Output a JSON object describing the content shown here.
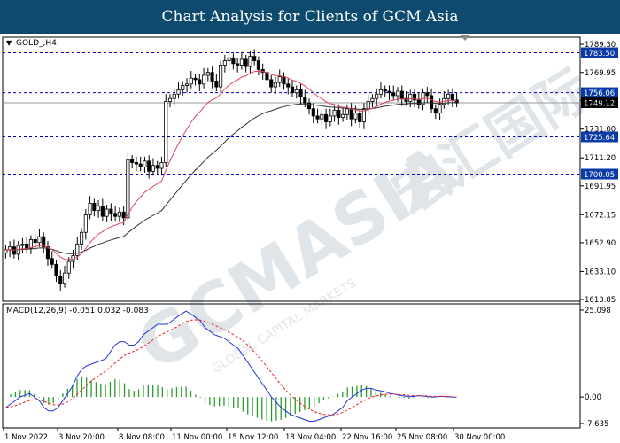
{
  "banner": {
    "title": "Chart Analysis for Clients of GCM Asia"
  },
  "watermark": {
    "text": "GCMASIA",
    "chinese": "宏汇国际",
    "sub": "GLOBAL CAPITAL MARKETS"
  },
  "colors": {
    "bull_candle": "#000000",
    "bear_candle": "#000000",
    "ma_fast": "#e0455a",
    "ma_slow": "#333333",
    "level_line": "#0000cc",
    "current_line": "#999999",
    "macd_line": "#2233dd",
    "signal_line": "#ee2222",
    "histogram": "#2e9a2e",
    "tag_blue": "#0a3aa8"
  },
  "chart_data": [
    {
      "type": "candlestick",
      "symbol_label": "GOLD_,H4",
      "ylim": [
        1613.85,
        1789.3
      ],
      "y_ticks": [
        1789.3,
        1769.95,
        1750.6,
        1731.0,
        1711.2,
        1691.95,
        1672.15,
        1652.9,
        1633.1,
        1613.85
      ],
      "y_tick_labels": [
        "1789.30",
        "1769.95",
        "1750.60",
        "1731.00",
        "1711.20",
        "1691.95",
        "1672.15",
        "1652.90",
        "1633.10",
        "1613.85"
      ],
      "x_labels": [
        "1 Nov 2022",
        "3 Nov 20:00",
        "8 Nov 08:00",
        "11 Nov 00:00",
        "15 Nov 12:00",
        "18 Nov 04:00",
        "22 Nov 16:00",
        "25 Nov 08:00",
        "30 Nov 00:00"
      ],
      "levels": [
        {
          "value": 1783.5,
          "label": "1783.50"
        },
        {
          "value": 1756.06,
          "label": "1756.06"
        },
        {
          "value": 1725.64,
          "label": "1725.64"
        },
        {
          "value": 1700.05,
          "label": "1700.05"
        }
      ],
      "current_price": {
        "value": 1749.12,
        "label": "1749.12"
      },
      "closes": [
        1648,
        1650,
        1645,
        1651,
        1652,
        1649,
        1655,
        1653,
        1657,
        1650,
        1642,
        1638,
        1630,
        1625,
        1632,
        1640,
        1644,
        1652,
        1660,
        1672,
        1680,
        1675,
        1678,
        1671,
        1676,
        1673,
        1671,
        1674,
        1670,
        1710,
        1708,
        1707,
        1705,
        1709,
        1702,
        1706,
        1704,
        1708,
        1750,
        1752,
        1755,
        1758,
        1761,
        1762,
        1766,
        1765,
        1762,
        1768,
        1770,
        1764,
        1760,
        1775,
        1778,
        1780,
        1776,
        1775,
        1779,
        1774,
        1781,
        1778,
        1772,
        1770,
        1765,
        1760,
        1763,
        1767,
        1762,
        1760,
        1756,
        1758,
        1753,
        1749,
        1745,
        1740,
        1738,
        1741,
        1736,
        1740,
        1744,
        1739,
        1741,
        1745,
        1738,
        1742,
        1736,
        1745,
        1750,
        1752,
        1755,
        1758,
        1757,
        1756,
        1754,
        1757,
        1752,
        1750,
        1755,
        1751,
        1748,
        1756,
        1754,
        1745,
        1742,
        1748,
        1752,
        1755,
        1751,
        1749
      ],
      "macd_ylim": [
        -7.635,
        25.098
      ],
      "macd_ticks": [
        25.098,
        0.0,
        -7.635
      ],
      "macd_tick_labels": [
        "25.098",
        "0.00",
        "-7.635"
      ],
      "macd": {
        "label": "MACD(12,26,9)",
        "value_main": "-0.051",
        "value_signal": "0.032",
        "value_hist": "-0.083",
        "main": [
          -3,
          -2,
          -1,
          0,
          0.5,
          1,
          0,
          -1,
          -3,
          -4,
          -4,
          -3,
          -1,
          1,
          3,
          6,
          8,
          9,
          9.5,
          10,
          10.5,
          11,
          13,
          15,
          16,
          16,
          15,
          15,
          16,
          18,
          19,
          20,
          21,
          21,
          21,
          22,
          23,
          24,
          24.8,
          24,
          23,
          22,
          20,
          19,
          18,
          17.5,
          17,
          16,
          15,
          14,
          12,
          10,
          8,
          6,
          4,
          2,
          0,
          -1.5,
          -3,
          -4,
          -5,
          -5.5,
          -6,
          -6.5,
          -7,
          -7,
          -6.5,
          -6,
          -5.5,
          -5,
          -4,
          -3,
          -1,
          0,
          1,
          2,
          2.5,
          2.5,
          2,
          1.8,
          1.5,
          1,
          0.8,
          0.5,
          0.3,
          0.1,
          0.2,
          0.4,
          0.3,
          0.1,
          0,
          0.1,
          0.2,
          0.1,
          0,
          -0.05
        ],
        "signal": [
          -3,
          -2.8,
          -2.5,
          -2,
          -1.5,
          -1,
          -0.8,
          -0.8,
          -1.2,
          -1.8,
          -2.2,
          -2.3,
          -2,
          -1.4,
          -0.5,
          0.8,
          2,
          3.4,
          4.6,
          5.7,
          6.6,
          7.5,
          8.6,
          9.8,
          11,
          12,
          12.7,
          13.2,
          13.8,
          14.6,
          15.5,
          16.5,
          17.4,
          18.2,
          18.8,
          19.5,
          20.2,
          21,
          21.8,
          22.2,
          22.3,
          22.2,
          21.8,
          21.3,
          20.7,
          20.1,
          19.5,
          18.8,
          18,
          17.2,
          16.2,
          15,
          13.6,
          12,
          10.5,
          8.8,
          7,
          5.3,
          3.6,
          2,
          0.6,
          -0.6,
          -1.7,
          -2.7,
          -3.5,
          -4.2,
          -4.7,
          -5,
          -5.1,
          -5.1,
          -4.9,
          -4.5,
          -3.8,
          -3,
          -2.2,
          -1.4,
          -0.7,
          -0.1,
          0.3,
          0.6,
          0.8,
          0.8,
          0.8,
          0.7,
          0.6,
          0.5,
          0.4,
          0.4,
          0.4,
          0.3,
          0.2,
          0.2,
          0.2,
          0.2,
          0.1,
          0.03
        ]
      }
    }
  ]
}
